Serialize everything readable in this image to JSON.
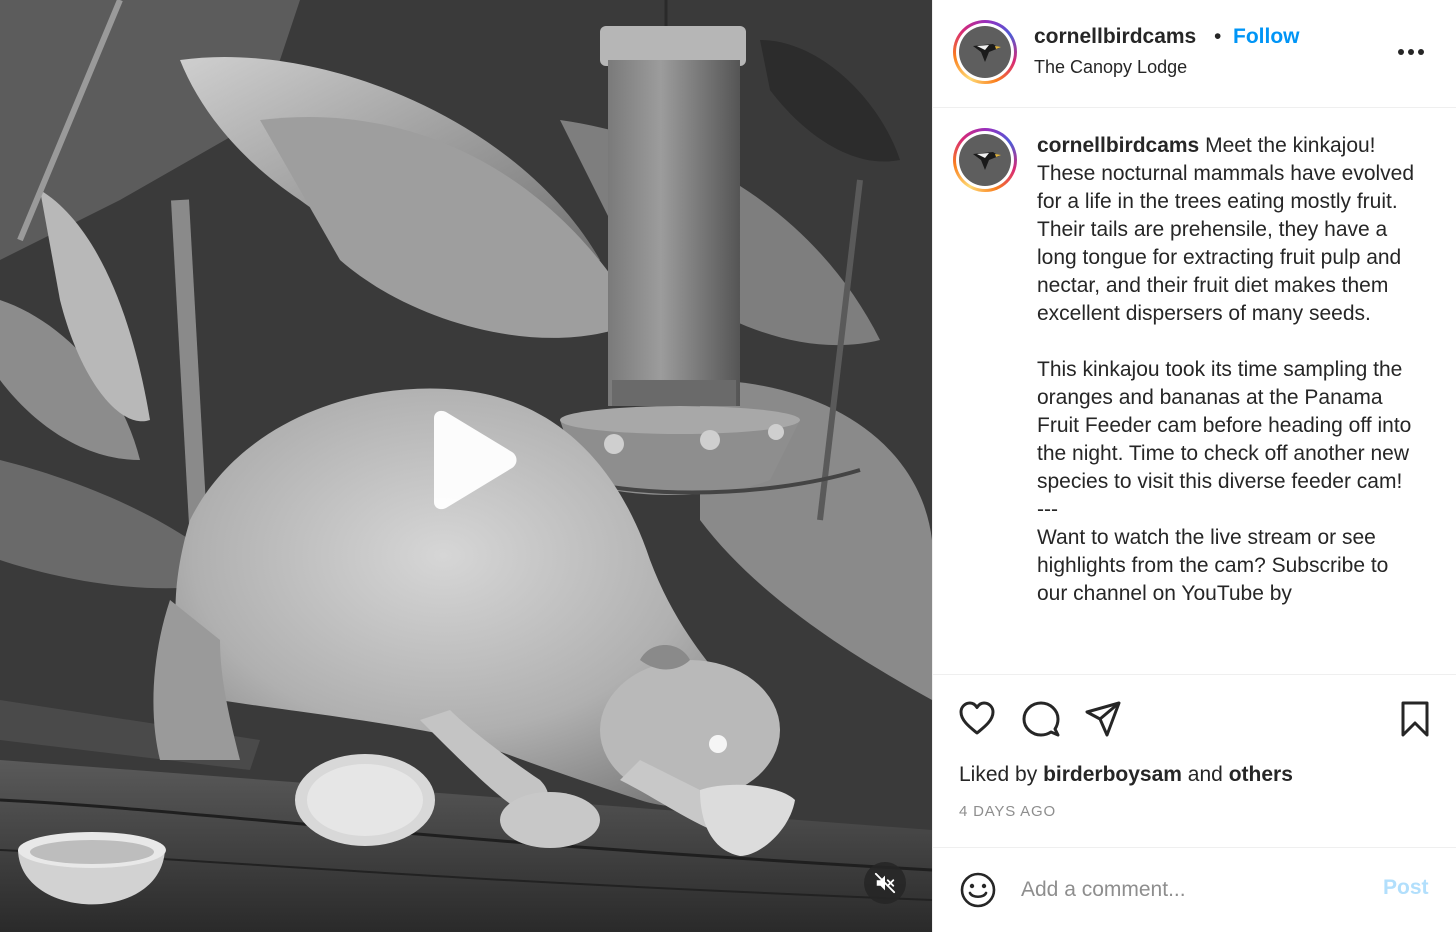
{
  "post": {
    "username": "cornellbirdcams",
    "separator": "•",
    "follow_label": "Follow",
    "location": "The Canopy Lodge"
  },
  "caption": {
    "username": "cornellbirdcams",
    "paragraph1": "Meet the kinkajou! These nocturnal mammals have evolved for a life in the trees eating mostly fruit. Their tails are prehensile, they have a long tongue for extracting fruit pulp and nectar, and their fruit diet makes them excellent dispersers of many seeds.",
    "paragraph2": "This kinkajou took its time sampling the oranges and bananas at the Panama Fruit Feeder cam before heading off into the night. Time to check off another new species to visit this diverse feeder cam!",
    "divider": "---",
    "paragraph3": "Want to watch the live stream or see highlights from the cam? Subscribe to our channel on YouTube by"
  },
  "engagement": {
    "liked_prefix": "Liked by",
    "liked_user": "birderboysam",
    "liked_connector": "and",
    "liked_others": "others",
    "timestamp": "4 DAYS AGO"
  },
  "comment": {
    "placeholder": "Add a comment...",
    "post_label": "Post"
  },
  "icons": {
    "like": "heart-icon",
    "comment": "comment-bubble-icon",
    "share": "paper-plane-icon",
    "save": "bookmark-icon",
    "more": "more-horizontal-icon",
    "emoji": "smiley-icon",
    "play": "play-icon",
    "mute": "muted-speaker-icon"
  },
  "colors": {
    "follow_blue": "#0095f6",
    "post_disabled": "#b2dffc",
    "muted_text": "#8e8e8e"
  }
}
